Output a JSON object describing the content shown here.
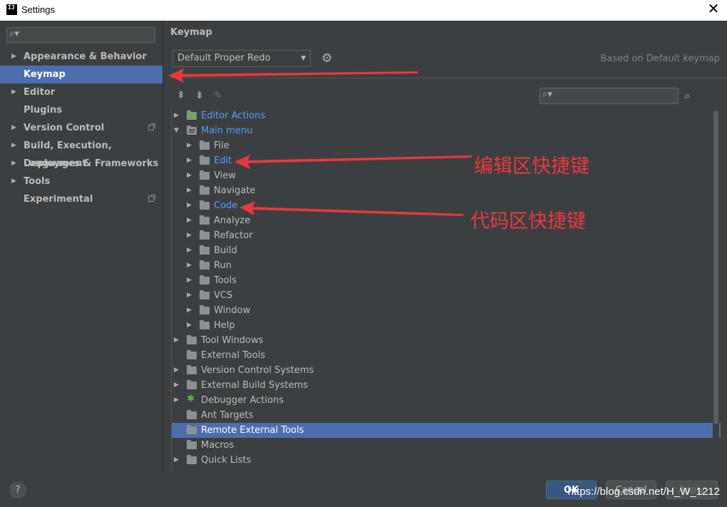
{
  "window": {
    "title": "Settings",
    "app_icon": "IJ"
  },
  "sidebar": {
    "search_placeholder": "",
    "items": [
      {
        "label": "Appearance & Behavior",
        "expandable": true
      },
      {
        "label": "Keymap",
        "selected": true
      },
      {
        "label": "Editor",
        "expandable": true
      },
      {
        "label": "Plugins"
      },
      {
        "label": "Version Control",
        "expandable": true,
        "project_icon": true
      },
      {
        "label": "Build, Execution, Deployment",
        "expandable": true
      },
      {
        "label": "Languages & Frameworks",
        "expandable": true
      },
      {
        "label": "Tools",
        "expandable": true
      },
      {
        "label": "Experimental",
        "project_icon": true
      }
    ]
  },
  "main": {
    "title": "Keymap",
    "keymap_select": "Default Proper Redo",
    "based_on": "Based on Default keymap",
    "tree": [
      {
        "label": "Editor Actions",
        "level": 0,
        "expandable": true,
        "link": true,
        "icon": "edited-folder-icon"
      },
      {
        "label": "Main menu",
        "level": 0,
        "expanded": true,
        "link": true,
        "icon": "menu-folder-icon"
      },
      {
        "label": "File",
        "level": 1,
        "expandable": true,
        "icon": "folder-icon"
      },
      {
        "label": "Edit",
        "level": 1,
        "expandable": true,
        "link": true,
        "icon": "folder-icon"
      },
      {
        "label": "View",
        "level": 1,
        "expandable": true,
        "icon": "folder-icon"
      },
      {
        "label": "Navigate",
        "level": 1,
        "expandable": true,
        "icon": "folder-icon"
      },
      {
        "label": "Code",
        "level": 1,
        "expandable": true,
        "link": true,
        "icon": "folder-icon"
      },
      {
        "label": "Analyze",
        "level": 1,
        "expandable": true,
        "icon": "folder-icon"
      },
      {
        "label": "Refactor",
        "level": 1,
        "expandable": true,
        "icon": "folder-icon"
      },
      {
        "label": "Build",
        "level": 1,
        "expandable": true,
        "icon": "folder-icon"
      },
      {
        "label": "Run",
        "level": 1,
        "expandable": true,
        "icon": "folder-icon"
      },
      {
        "label": "Tools",
        "level": 1,
        "expandable": true,
        "icon": "folder-icon"
      },
      {
        "label": "VCS",
        "level": 1,
        "expandable": true,
        "icon": "folder-icon"
      },
      {
        "label": "Window",
        "level": 1,
        "expandable": true,
        "icon": "folder-icon"
      },
      {
        "label": "Help",
        "level": 1,
        "expandable": true,
        "icon": "folder-icon"
      },
      {
        "label": "Tool Windows",
        "level": 0,
        "expandable": true,
        "icon": "folder-icon"
      },
      {
        "label": "External Tools",
        "level": 0,
        "icon": "folder-icon"
      },
      {
        "label": "Version Control Systems",
        "level": 0,
        "expandable": true,
        "icon": "folder-icon"
      },
      {
        "label": "External Build Systems",
        "level": 0,
        "expandable": true,
        "icon": "folder-icon"
      },
      {
        "label": "Debugger Actions",
        "level": 0,
        "expandable": true,
        "icon": "bug-icon"
      },
      {
        "label": "Ant Targets",
        "level": 0,
        "icon": "folder-icon"
      },
      {
        "label": "Remote External Tools",
        "level": 0,
        "selected": true,
        "icon": "folder-icon"
      },
      {
        "label": "Macros",
        "level": 0,
        "icon": "folder-icon"
      },
      {
        "label": "Quick Lists",
        "level": 0,
        "expandable": true,
        "icon": "folder-icon"
      }
    ]
  },
  "footer": {
    "help": "?",
    "ok": "OK",
    "cancel": "Cancel",
    "apply": "Apply"
  },
  "watermark": "https://blog.csdn.net/H_W_1212",
  "annotations": {
    "edit_label": "编辑区快捷键",
    "code_label": "代码区快捷键",
    "color": "#e8383d"
  },
  "colors": {
    "accent": "#4b6eaf",
    "link": "#589df6",
    "background": "#3c3f41"
  }
}
